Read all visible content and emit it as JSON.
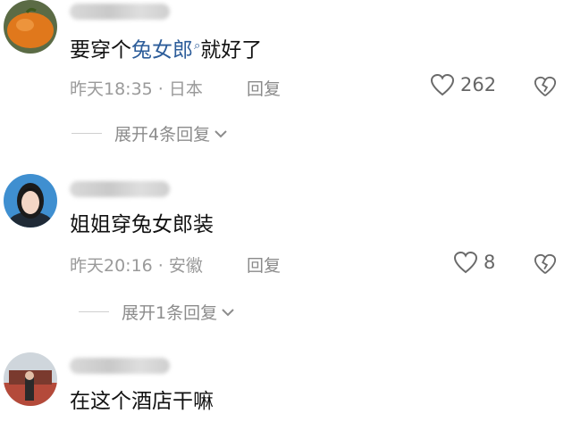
{
  "comments": [
    {
      "text_prefix": "要穿个",
      "link_text": "兔女郎",
      "text_suffix": "就好了",
      "meta": "昨天18:35 · 日本",
      "reply_label": "回复",
      "likes": "262",
      "expand_label": "展开4条回复"
    },
    {
      "text": "姐姐穿兔女郎装",
      "meta": "昨天20:16 · 安徽",
      "reply_label": "回复",
      "likes": "8",
      "expand_label": "展开1条回复"
    },
    {
      "text": "在这个酒店干嘛"
    }
  ],
  "icons": {
    "like": "heart-icon",
    "dislike": "broken-heart-icon",
    "expand": "chevron-down-icon",
    "link_search": "search-icon"
  }
}
